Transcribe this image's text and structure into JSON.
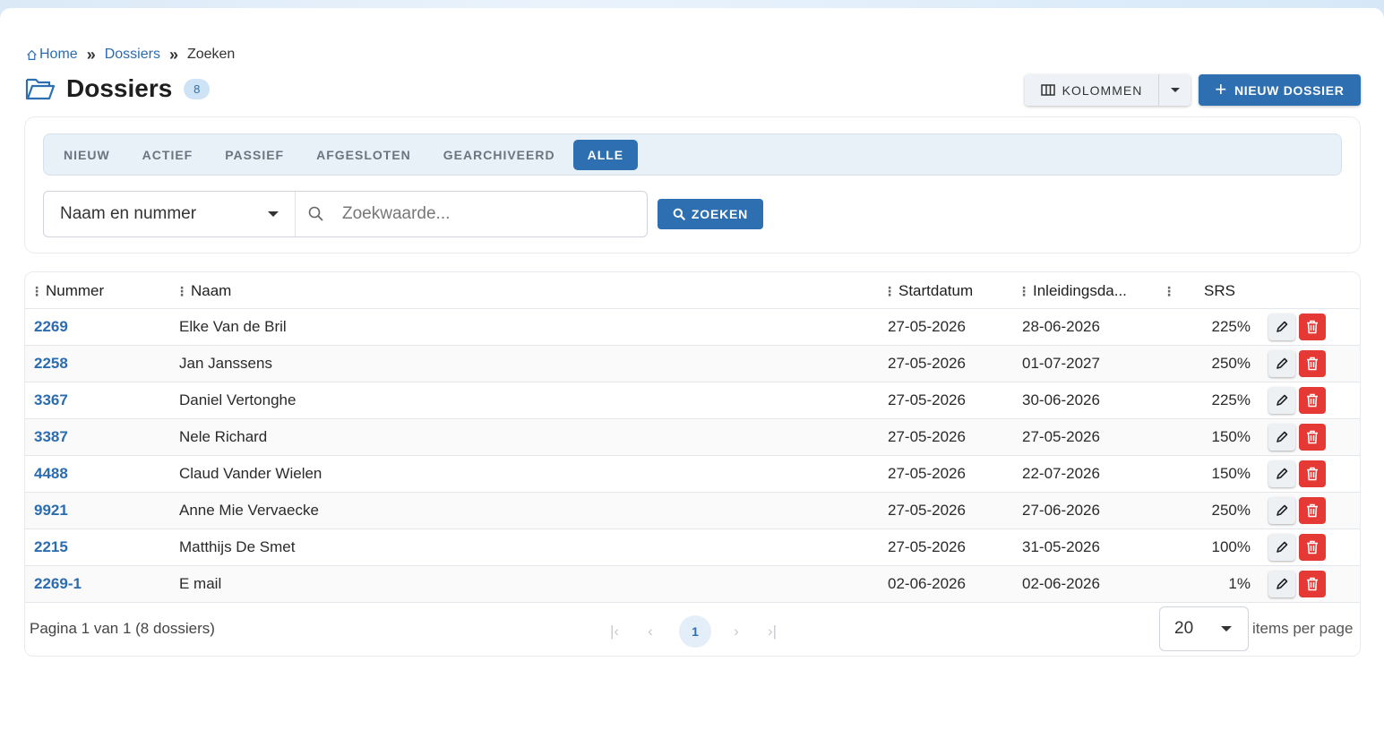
{
  "breadcrumb": {
    "home": "Home",
    "section": "Dossiers",
    "current": "Zoeken",
    "separator": "»"
  },
  "header": {
    "title": "Dossiers",
    "count": "8",
    "columns_label": "KOLOMMEN",
    "new_label": "NIEUW DOSSIER",
    "new_plus": "+"
  },
  "tabs": [
    "NIEUW",
    "ACTIEF",
    "PASSIEF",
    "AFGESLOTEN",
    "GEARCHIVEERD",
    "ALLE"
  ],
  "search": {
    "field_selected": "Naam en nummer",
    "placeholder": "Zoekwaarde...",
    "button_label": "ZOEKEN"
  },
  "table": {
    "columns": [
      "Nummer",
      "Naam",
      "Startdatum",
      "Inleidingsda...",
      "SRS"
    ],
    "rows": [
      {
        "nummer": "2269",
        "naam": "Elke Van de Bril",
        "start": "27-05-2026",
        "inleiding": "28-06-2026",
        "srs": "225%"
      },
      {
        "nummer": "2258",
        "naam": "Jan Janssens",
        "start": "27-05-2026",
        "inleiding": "01-07-2027",
        "srs": "250%"
      },
      {
        "nummer": "3367",
        "naam": "Daniel Vertonghe",
        "start": "27-05-2026",
        "inleiding": "30-06-2026",
        "srs": "225%"
      },
      {
        "nummer": "3387",
        "naam": "Nele Richard",
        "start": "27-05-2026",
        "inleiding": "27-05-2026",
        "srs": "150%"
      },
      {
        "nummer": "4488",
        "naam": "Claud Vander Wielen",
        "start": "27-05-2026",
        "inleiding": "22-07-2026",
        "srs": "150%"
      },
      {
        "nummer": "9921",
        "naam": "Anne Mie Vervaecke",
        "start": "27-05-2026",
        "inleiding": "27-06-2026",
        "srs": "250%"
      },
      {
        "nummer": "2215",
        "naam": "Matthijs De Smet",
        "start": "27-05-2026",
        "inleiding": "31-05-2026",
        "srs": "100%"
      },
      {
        "nummer": "2269-1",
        "naam": "E mail",
        "start": "02-06-2026",
        "inleiding": "02-06-2026",
        "srs": "1%"
      }
    ]
  },
  "footer": {
    "page_info": "Pagina 1 van 1 (8 dossiers)",
    "current_page": "1",
    "per_page": "20",
    "per_page_label": "items per page"
  },
  "colors": {
    "primary": "#2d6fb1",
    "link": "#2b6cb0",
    "danger": "#e53935",
    "badge_bg": "#cfe3f6"
  }
}
